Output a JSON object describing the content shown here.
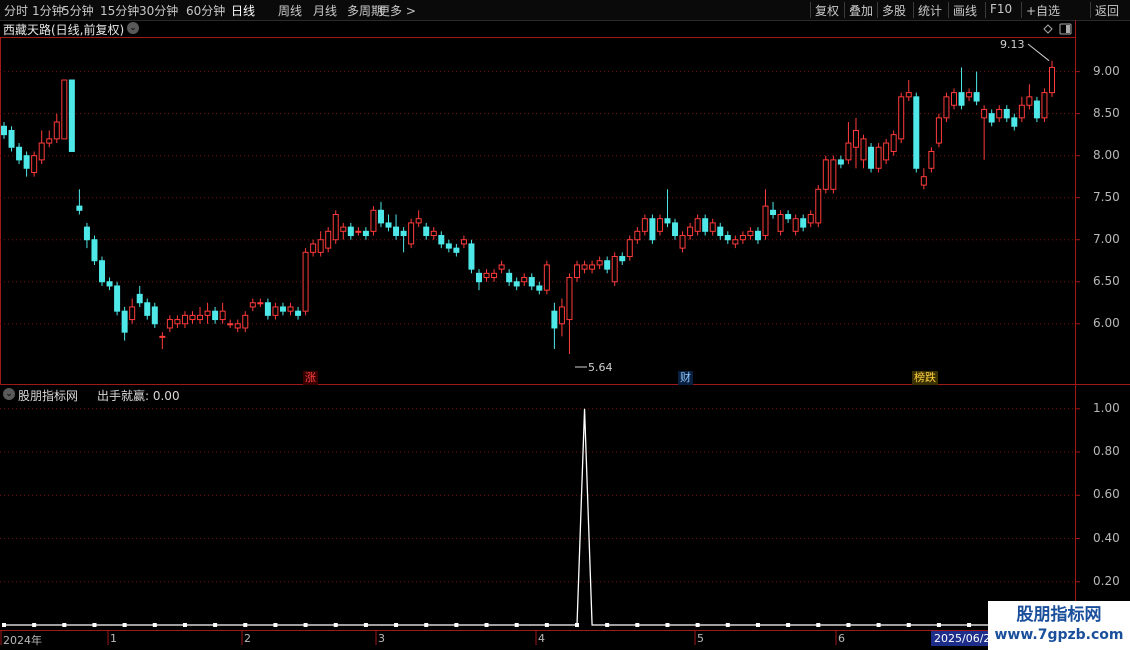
{
  "toolbar": {
    "periods": [
      "分时",
      "1分钟",
      "5分钟",
      "15分钟",
      "30分钟",
      "60分钟",
      "日线",
      "周线",
      "月线",
      "多周期",
      "更多 >"
    ],
    "active_period": "日线",
    "right_buttons": [
      "复权",
      "叠加",
      "多股",
      "统计",
      "画线",
      "F10",
      "+自选",
      "返回"
    ]
  },
  "main_panel": {
    "title": "西藏天路(日线,前复权)",
    "chevron": "⌄",
    "max_label": "9.13",
    "min_label": "5.64",
    "event_tags": [
      {
        "text": "涨",
        "color": "#ff4040"
      },
      {
        "text": "财",
        "color": "#8fc8ff"
      },
      {
        "text": "榜跌",
        "color": "#ffd040"
      }
    ],
    "y_ticks": [
      "9.00",
      "8.50",
      "8.00",
      "7.50",
      "7.00",
      "6.50",
      "6.00"
    ]
  },
  "indicator_panel": {
    "name": "股朋指标网",
    "label": "出手就赢: 0.00",
    "y_ticks": [
      "1.00",
      "0.80",
      "0.60",
      "0.40",
      "0.20"
    ]
  },
  "x_axis": {
    "ticks": [
      "2024年",
      "1",
      "2",
      "3",
      "4",
      "5",
      "6"
    ],
    "highlight_date": "2025/06/2"
  },
  "watermark": {
    "line1": "股朋指标网",
    "line2": "www.7gpzb.com"
  },
  "colors": {
    "up": "#ff3b3b",
    "down": "#4ee8e8",
    "grid": "#7a1010",
    "frame": "#a01818",
    "line": "#ffffff",
    "bg": "#000000"
  },
  "chart_data": {
    "type": "candlestick",
    "ylim": [
      5.45,
      9.4
    ],
    "candles": [
      {
        "o": 8.35,
        "c": 8.25,
        "h": 8.4,
        "l": 8.2
      },
      {
        "o": 8.3,
        "c": 8.1,
        "h": 8.35,
        "l": 8.05
      },
      {
        "o": 8.1,
        "c": 7.95,
        "h": 8.15,
        "l": 7.9
      },
      {
        "o": 8.0,
        "c": 7.85,
        "h": 8.05,
        "l": 7.75
      },
      {
        "o": 7.8,
        "c": 8.0,
        "h": 8.05,
        "l": 7.75
      },
      {
        "o": 7.95,
        "c": 8.15,
        "h": 8.3,
        "l": 7.9
      },
      {
        "o": 8.15,
        "c": 8.2,
        "h": 8.3,
        "l": 8.1
      },
      {
        "o": 8.2,
        "c": 8.4,
        "h": 8.5,
        "l": 8.15
      },
      {
        "o": 8.2,
        "c": 8.9,
        "h": 8.9,
        "l": 8.2
      },
      {
        "o": 8.9,
        "c": 8.05,
        "h": 8.9,
        "l": 8.05
      },
      {
        "o": 7.4,
        "c": 7.35,
        "h": 7.6,
        "l": 7.3
      },
      {
        "o": 7.15,
        "c": 7.0,
        "h": 7.2,
        "l": 6.9
      },
      {
        "o": 7.0,
        "c": 6.75,
        "h": 7.05,
        "l": 6.7
      },
      {
        "o": 6.75,
        "c": 6.5,
        "h": 6.8,
        "l": 6.45
      },
      {
        "o": 6.5,
        "c": 6.45,
        "h": 6.55,
        "l": 6.4
      },
      {
        "o": 6.45,
        "c": 6.15,
        "h": 6.5,
        "l": 6.1
      },
      {
        "o": 6.15,
        "c": 5.9,
        "h": 6.2,
        "l": 5.8
      },
      {
        "o": 6.05,
        "c": 6.2,
        "h": 6.3,
        "l": 6.0
      },
      {
        "o": 6.35,
        "c": 6.25,
        "h": 6.45,
        "l": 6.2
      },
      {
        "o": 6.25,
        "c": 6.1,
        "h": 6.3,
        "l": 6.05
      },
      {
        "o": 6.2,
        "c": 6.0,
        "h": 6.25,
        "l": 5.95
      },
      {
        "o": 5.85,
        "c": 5.85,
        "h": 5.9,
        "l": 5.7
      },
      {
        "o": 5.95,
        "c": 6.05,
        "h": 6.1,
        "l": 5.9
      },
      {
        "o": 6.0,
        "c": 6.05,
        "h": 6.1,
        "l": 5.95
      },
      {
        "o": 6.0,
        "c": 6.1,
        "h": 6.15,
        "l": 5.95
      },
      {
        "o": 6.05,
        "c": 6.1,
        "h": 6.15,
        "l": 6.0
      },
      {
        "o": 6.05,
        "c": 6.1,
        "h": 6.2,
        "l": 6.0
      },
      {
        "o": 6.1,
        "c": 6.15,
        "h": 6.25,
        "l": 6.0
      },
      {
        "o": 6.15,
        "c": 6.05,
        "h": 6.2,
        "l": 6.0
      },
      {
        "o": 6.05,
        "c": 6.15,
        "h": 6.25,
        "l": 6.0
      },
      {
        "o": 6.0,
        "c": 6.0,
        "h": 6.05,
        "l": 5.95
      },
      {
        "o": 5.95,
        "c": 6.0,
        "h": 6.05,
        "l": 5.9
      },
      {
        "o": 5.95,
        "c": 6.1,
        "h": 6.15,
        "l": 5.9
      },
      {
        "o": 6.2,
        "c": 6.25,
        "h": 6.3,
        "l": 6.15
      },
      {
        "o": 6.25,
        "c": 6.25,
        "h": 6.3,
        "l": 6.2
      },
      {
        "o": 6.25,
        "c": 6.1,
        "h": 6.3,
        "l": 6.05
      },
      {
        "o": 6.1,
        "c": 6.2,
        "h": 6.25,
        "l": 6.05
      },
      {
        "o": 6.2,
        "c": 6.15,
        "h": 6.25,
        "l": 6.1
      },
      {
        "o": 6.15,
        "c": 6.2,
        "h": 6.25,
        "l": 6.1
      },
      {
        "o": 6.15,
        "c": 6.1,
        "h": 6.2,
        "l": 6.05
      },
      {
        "o": 6.15,
        "c": 6.85,
        "h": 6.9,
        "l": 6.1
      },
      {
        "o": 6.85,
        "c": 6.95,
        "h": 7.0,
        "l": 6.8
      },
      {
        "o": 6.85,
        "c": 7.0,
        "h": 7.1,
        "l": 6.8
      },
      {
        "o": 6.9,
        "c": 7.1,
        "h": 7.15,
        "l": 6.85
      },
      {
        "o": 7.0,
        "c": 7.3,
        "h": 7.35,
        "l": 6.95
      },
      {
        "o": 7.1,
        "c": 7.15,
        "h": 7.2,
        "l": 7.0
      },
      {
        "o": 7.15,
        "c": 7.05,
        "h": 7.2,
        "l": 7.0
      },
      {
        "o": 7.1,
        "c": 7.1,
        "h": 7.15,
        "l": 7.05
      },
      {
        "o": 7.1,
        "c": 7.05,
        "h": 7.15,
        "l": 7.0
      },
      {
        "o": 7.1,
        "c": 7.35,
        "h": 7.4,
        "l": 7.05
      },
      {
        "o": 7.35,
        "c": 7.2,
        "h": 7.45,
        "l": 7.15
      },
      {
        "o": 7.2,
        "c": 7.15,
        "h": 7.3,
        "l": 7.1
      },
      {
        "o": 7.15,
        "c": 7.05,
        "h": 7.3,
        "l": 7.0
      },
      {
        "o": 7.1,
        "c": 7.05,
        "h": 7.15,
        "l": 6.85
      },
      {
        "o": 6.95,
        "c": 7.2,
        "h": 7.25,
        "l": 6.9
      },
      {
        "o": 7.2,
        "c": 7.25,
        "h": 7.35,
        "l": 7.15
      },
      {
        "o": 7.15,
        "c": 7.05,
        "h": 7.2,
        "l": 7.0
      },
      {
        "o": 7.05,
        "c": 7.1,
        "h": 7.15,
        "l": 7.0
      },
      {
        "o": 7.05,
        "c": 6.95,
        "h": 7.1,
        "l": 6.9
      },
      {
        "o": 6.95,
        "c": 6.9,
        "h": 7.0,
        "l": 6.85
      },
      {
        "o": 6.9,
        "c": 6.85,
        "h": 6.95,
        "l": 6.8
      },
      {
        "o": 6.95,
        "c": 7.0,
        "h": 7.05,
        "l": 6.9
      },
      {
        "o": 6.95,
        "c": 6.65,
        "h": 7.0,
        "l": 6.6
      },
      {
        "o": 6.6,
        "c": 6.5,
        "h": 6.65,
        "l": 6.4
      },
      {
        "o": 6.55,
        "c": 6.6,
        "h": 6.65,
        "l": 6.5
      },
      {
        "o": 6.55,
        "c": 6.6,
        "h": 6.65,
        "l": 6.5
      },
      {
        "o": 6.65,
        "c": 6.7,
        "h": 6.75,
        "l": 6.6
      },
      {
        "o": 6.6,
        "c": 6.5,
        "h": 6.65,
        "l": 6.45
      },
      {
        "o": 6.5,
        "c": 6.45,
        "h": 6.55,
        "l": 6.4
      },
      {
        "o": 6.5,
        "c": 6.55,
        "h": 6.6,
        "l": 6.45
      },
      {
        "o": 6.55,
        "c": 6.45,
        "h": 6.6,
        "l": 6.4
      },
      {
        "o": 6.45,
        "c": 6.4,
        "h": 6.5,
        "l": 6.35
      },
      {
        "o": 6.4,
        "c": 6.7,
        "h": 6.75,
        "l": 6.35
      },
      {
        "o": 6.15,
        "c": 5.95,
        "h": 6.25,
        "l": 5.7
      },
      {
        "o": 6.0,
        "c": 6.2,
        "h": 6.3,
        "l": 5.85
      },
      {
        "o": 6.05,
        "c": 6.55,
        "h": 6.6,
        "l": 5.64
      },
      {
        "o": 6.55,
        "c": 6.7,
        "h": 6.75,
        "l": 6.5
      },
      {
        "o": 6.65,
        "c": 6.7,
        "h": 6.75,
        "l": 6.6
      },
      {
        "o": 6.65,
        "c": 6.7,
        "h": 6.75,
        "l": 6.6
      },
      {
        "o": 6.7,
        "c": 6.75,
        "h": 6.8,
        "l": 6.65
      },
      {
        "o": 6.75,
        "c": 6.65,
        "h": 6.8,
        "l": 6.6
      },
      {
        "o": 6.5,
        "c": 6.8,
        "h": 6.85,
        "l": 6.45
      },
      {
        "o": 6.8,
        "c": 6.75,
        "h": 6.85,
        "l": 6.7
      },
      {
        "o": 6.8,
        "c": 7.0,
        "h": 7.05,
        "l": 6.75
      },
      {
        "o": 7.0,
        "c": 7.1,
        "h": 7.15,
        "l": 6.95
      },
      {
        "o": 7.1,
        "c": 7.25,
        "h": 7.3,
        "l": 7.05
      },
      {
        "o": 7.25,
        "c": 7.0,
        "h": 7.3,
        "l": 6.95
      },
      {
        "o": 7.1,
        "c": 7.25,
        "h": 7.3,
        "l": 7.05
      },
      {
        "o": 7.25,
        "c": 7.2,
        "h": 7.6,
        "l": 7.15
      },
      {
        "o": 7.2,
        "c": 7.05,
        "h": 7.25,
        "l": 7.0
      },
      {
        "o": 6.9,
        "c": 7.05,
        "h": 7.1,
        "l": 6.85
      },
      {
        "o": 7.05,
        "c": 7.15,
        "h": 7.2,
        "l": 7.0
      },
      {
        "o": 7.1,
        "c": 7.25,
        "h": 7.3,
        "l": 7.05
      },
      {
        "o": 7.25,
        "c": 7.1,
        "h": 7.3,
        "l": 7.05
      },
      {
        "o": 7.1,
        "c": 7.2,
        "h": 7.25,
        "l": 7.05
      },
      {
        "o": 7.15,
        "c": 7.05,
        "h": 7.2,
        "l": 7.0
      },
      {
        "o": 7.05,
        "c": 7.0,
        "h": 7.1,
        "l": 6.95
      },
      {
        "o": 6.95,
        "c": 7.0,
        "h": 7.05,
        "l": 6.9
      },
      {
        "o": 7.0,
        "c": 7.05,
        "h": 7.1,
        "l": 6.95
      },
      {
        "o": 7.05,
        "c": 7.1,
        "h": 7.15,
        "l": 7.0
      },
      {
        "o": 7.1,
        "c": 7.0,
        "h": 7.15,
        "l": 6.95
      },
      {
        "o": 7.05,
        "c": 7.4,
        "h": 7.6,
        "l": 7.0
      },
      {
        "o": 7.35,
        "c": 7.3,
        "h": 7.45,
        "l": 7.25
      },
      {
        "o": 7.1,
        "c": 7.3,
        "h": 7.35,
        "l": 7.05
      },
      {
        "o": 7.3,
        "c": 7.25,
        "h": 7.35,
        "l": 7.2
      },
      {
        "o": 7.1,
        "c": 7.25,
        "h": 7.3,
        "l": 7.05
      },
      {
        "o": 7.25,
        "c": 7.15,
        "h": 7.3,
        "l": 7.1
      },
      {
        "o": 7.2,
        "c": 7.3,
        "h": 7.35,
        "l": 7.15
      },
      {
        "o": 7.2,
        "c": 7.6,
        "h": 7.65,
        "l": 7.15
      },
      {
        "o": 7.6,
        "c": 7.95,
        "h": 8.0,
        "l": 7.55
      },
      {
        "o": 7.6,
        "c": 7.95,
        "h": 8.0,
        "l": 7.55
      },
      {
        "o": 7.95,
        "c": 7.9,
        "h": 8.0,
        "l": 7.85
      },
      {
        "o": 7.95,
        "c": 8.15,
        "h": 8.4,
        "l": 7.9
      },
      {
        "o": 8.1,
        "c": 8.3,
        "h": 8.45,
        "l": 7.85
      },
      {
        "o": 7.95,
        "c": 8.2,
        "h": 8.25,
        "l": 7.85
      },
      {
        "o": 8.1,
        "c": 7.85,
        "h": 8.15,
        "l": 7.8
      },
      {
        "o": 7.85,
        "c": 8.1,
        "h": 8.15,
        "l": 7.8
      },
      {
        "o": 7.95,
        "c": 8.15,
        "h": 8.2,
        "l": 7.9
      },
      {
        "o": 8.05,
        "c": 8.25,
        "h": 8.3,
        "l": 8.0
      },
      {
        "o": 8.2,
        "c": 8.7,
        "h": 8.75,
        "l": 8.15
      },
      {
        "o": 8.7,
        "c": 8.75,
        "h": 8.9,
        "l": 8.65
      },
      {
        "o": 8.7,
        "c": 7.85,
        "h": 8.75,
        "l": 7.8
      },
      {
        "o": 7.65,
        "c": 7.75,
        "h": 7.85,
        "l": 7.6
      },
      {
        "o": 7.85,
        "c": 8.05,
        "h": 8.1,
        "l": 7.8
      },
      {
        "o": 8.15,
        "c": 8.45,
        "h": 8.5,
        "l": 8.1
      },
      {
        "o": 8.45,
        "c": 8.7,
        "h": 8.75,
        "l": 8.4
      },
      {
        "o": 8.6,
        "c": 8.75,
        "h": 8.8,
        "l": 8.55
      },
      {
        "o": 8.75,
        "c": 8.6,
        "h": 9.05,
        "l": 8.55
      },
      {
        "o": 8.7,
        "c": 8.75,
        "h": 8.8,
        "l": 8.65
      },
      {
        "o": 8.75,
        "c": 8.65,
        "h": 9.0,
        "l": 8.6
      },
      {
        "o": 8.45,
        "c": 8.55,
        "h": 8.6,
        "l": 7.95
      },
      {
        "o": 8.5,
        "c": 8.4,
        "h": 8.55,
        "l": 8.35
      },
      {
        "o": 8.45,
        "c": 8.55,
        "h": 8.6,
        "l": 8.4
      },
      {
        "o": 8.55,
        "c": 8.45,
        "h": 8.6,
        "l": 8.4
      },
      {
        "o": 8.45,
        "c": 8.35,
        "h": 8.5,
        "l": 8.3
      },
      {
        "o": 8.45,
        "c": 8.6,
        "h": 8.7,
        "l": 8.4
      },
      {
        "o": 8.6,
        "c": 8.7,
        "h": 8.85,
        "l": 8.55
      },
      {
        "o": 8.65,
        "c": 8.45,
        "h": 8.7,
        "l": 8.4
      },
      {
        "o": 8.45,
        "c": 8.75,
        "h": 8.8,
        "l": 8.4
      },
      {
        "o": 8.75,
        "c": 9.05,
        "h": 9.13,
        "l": 8.7
      }
    ],
    "indicator": {
      "name": "出手就赢",
      "values_spike_index": 77,
      "baseline": 0.0,
      "peak": 1.0,
      "ylim": [
        0,
        1.05
      ]
    }
  }
}
